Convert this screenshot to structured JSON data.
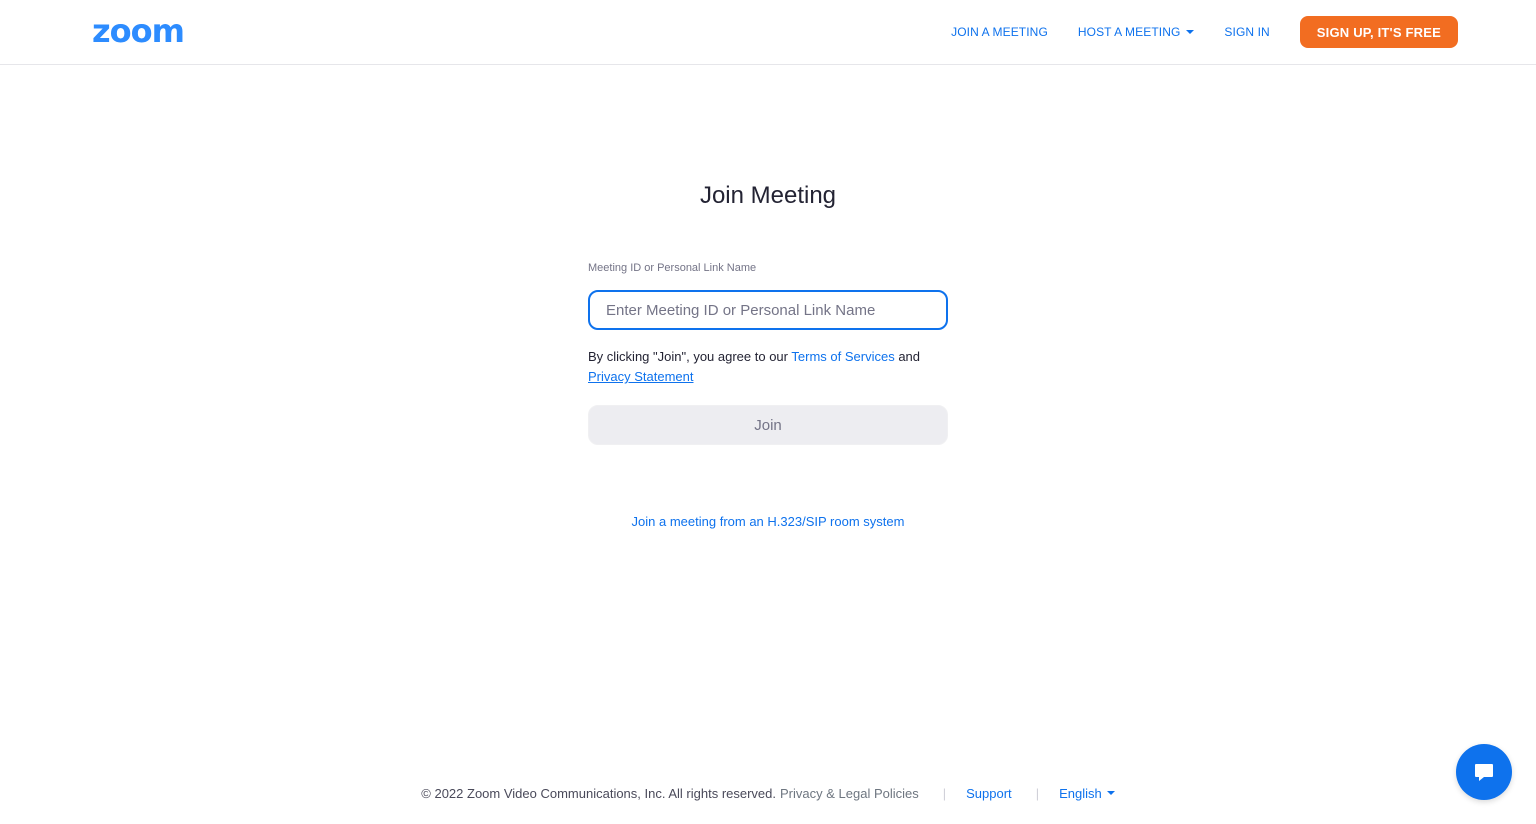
{
  "header": {
    "logo": "zoom",
    "nav": {
      "join": "JOIN A MEETING",
      "host": "HOST A MEETING",
      "signin": "SIGN IN",
      "signup": "SIGN UP, IT'S FREE"
    }
  },
  "main": {
    "title": "Join Meeting",
    "field_label": "Meeting ID or Personal Link Name",
    "input_placeholder": "Enter Meeting ID or Personal Link Name",
    "input_value": "",
    "agree_prefix": "By clicking \"Join\", you agree to our",
    "terms_link": "Terms of Services",
    "agree_and": "and",
    "privacy_link": "Privacy Statement",
    "join_button": "Join",
    "sip_link": "Join a meeting from an H.323/SIP room system"
  },
  "footer": {
    "copyright": "© 2022 Zoom Video Communications, Inc. All rights reserved.",
    "privacy_legal": "Privacy & Legal Policies",
    "support": "Support",
    "language": "English"
  },
  "icons": {
    "host_caret": "caret-down-icon",
    "language_caret": "caret-down-icon",
    "chat": "chat-bubble-icon"
  },
  "colors": {
    "brand": "#2D8CFF",
    "link": "#0E72ED",
    "signup": "#F26D21",
    "join_disabled_bg": "#EDEDF1"
  }
}
